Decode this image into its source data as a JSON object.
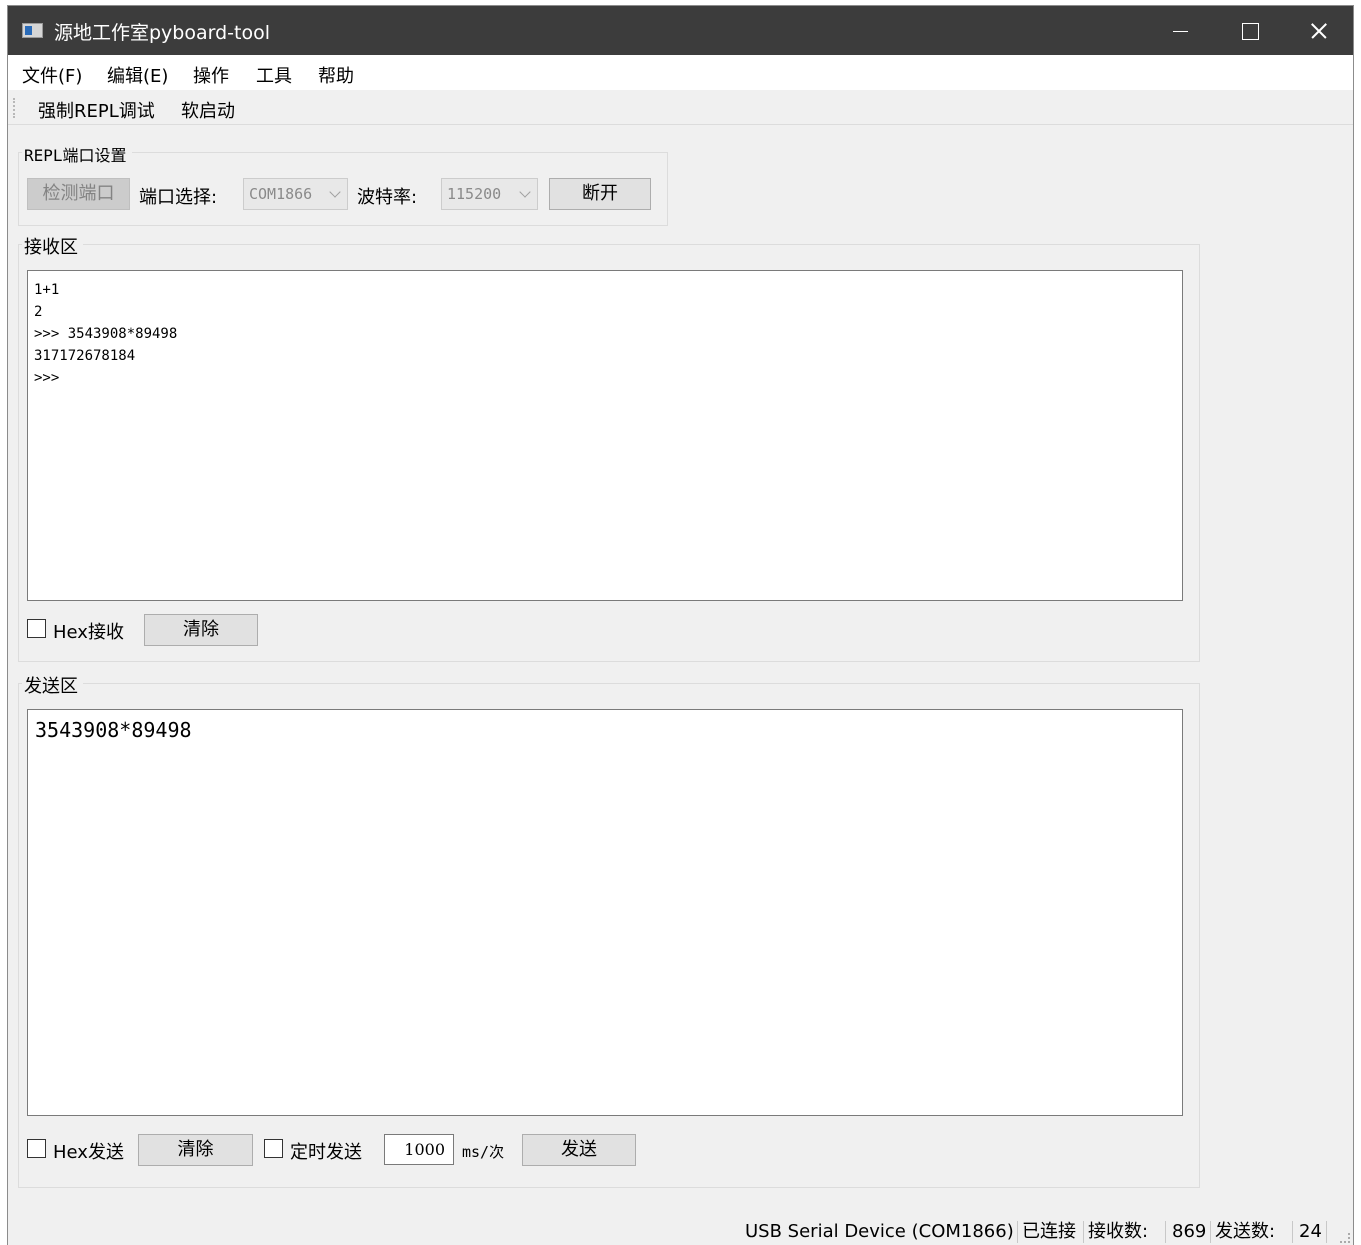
{
  "window": {
    "title": "源地工作室pyboard-tool"
  },
  "menu": {
    "items": [
      "文件(F)",
      "编辑(E)",
      "操作",
      "工具",
      "帮助"
    ]
  },
  "toolbar": {
    "items": [
      "强制REPL调试",
      "软启动"
    ]
  },
  "port_settings": {
    "title": "REPL端口设置",
    "detect_button": "检测端口",
    "port_label": "端口选择:",
    "port_value": "COM1866",
    "baud_label": "波特率:",
    "baud_value": "115200",
    "disconnect_button": "断开"
  },
  "receive": {
    "title": "接收区",
    "lines": [
      "1+1",
      "2",
      ">>> 3543908*89498",
      "317172678184",
      ">>>"
    ],
    "hex_label": "Hex接收",
    "hex_checked": false,
    "clear_button": "清除"
  },
  "send": {
    "title": "发送区",
    "text": "3543908*89498",
    "hex_label": "Hex发送",
    "hex_checked": false,
    "clear_button": "清除",
    "timer_label": "定时发送",
    "timer_checked": false,
    "interval_value": "1000",
    "interval_unit": "ms/次",
    "send_button": "发送"
  },
  "status": {
    "device": "USB Serial Device (COM1866)",
    "connection": "已连接",
    "recv_label": "接收数:",
    "recv_count": "869",
    "send_label": "发送数:",
    "send_count": "24"
  }
}
